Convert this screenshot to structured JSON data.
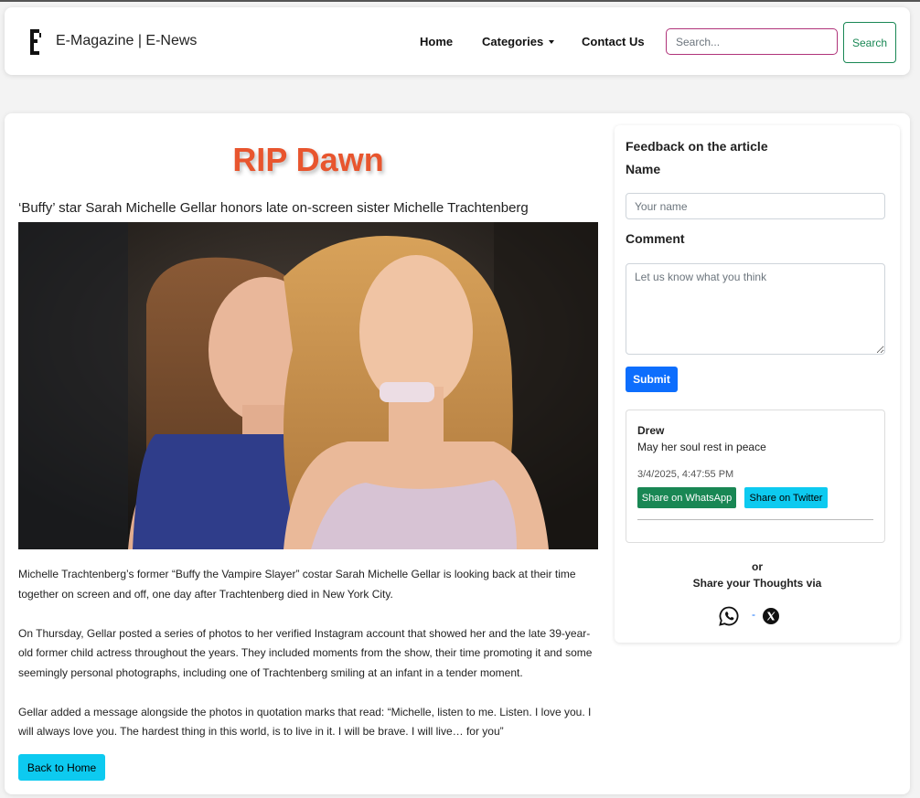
{
  "navbar": {
    "brand": "E-Magazine | E-News",
    "links": {
      "home": "Home",
      "categories": "Categories",
      "contact": "Contact Us"
    },
    "search_placeholder": "Search...",
    "search_button": "Search"
  },
  "article": {
    "title": "RIP Dawn",
    "subtitle": "‘Buffy’ star Sarah Michelle Gellar honors late on-screen sister Michelle Trachtenberg",
    "paragraphs": [
      "Michelle Trachtenberg’s former “Buffy the Vampire Slayer” costar Sarah Michelle Gellar is looking back at their time together on screen and off, one day after Trachtenberg died in New York City.",
      "On Thursday, Gellar posted a series of photos to her verified Instagram account that showed her and the late 39-year-old former child actress throughout the years. They included moments from the show, their time promoting it and some seemingly personal photographs, including one of Trachtenberg smiling at an infant in a tender moment.",
      "Gellar added a message alongside the photos in quotation marks that read: “Michelle, listen to me. Listen. I love you. I will always love you. The hardest thing in this world, is to live in it. I will be brave. I will live… for you”"
    ],
    "back_button": "Back to Home"
  },
  "sidebar": {
    "heading": "Feedback on the article",
    "name_label": "Name",
    "name_placeholder": "Your name",
    "comment_label": "Comment",
    "comment_placeholder": "Let us know what you think",
    "submit": "Submit",
    "comments": [
      {
        "author": "Drew",
        "text": "May her soul rest in peace",
        "time": "3/4/2025, 4:47:55 PM",
        "whatsapp_button": "Share on WhatsApp",
        "twitter_button": "Share on Twitter"
      }
    ],
    "or_text": "or",
    "share_text": "Share your Thoughts via",
    "separator": "-"
  },
  "colors": {
    "title": "#e8552e",
    "primary": "#0d6efd",
    "success": "#198754",
    "info": "#0dcaf0",
    "search_border": "#b0337a"
  },
  "icons": {
    "brand": "e-logo-icon",
    "whatsapp": "whatsapp-icon",
    "x": "x-twitter-icon"
  }
}
